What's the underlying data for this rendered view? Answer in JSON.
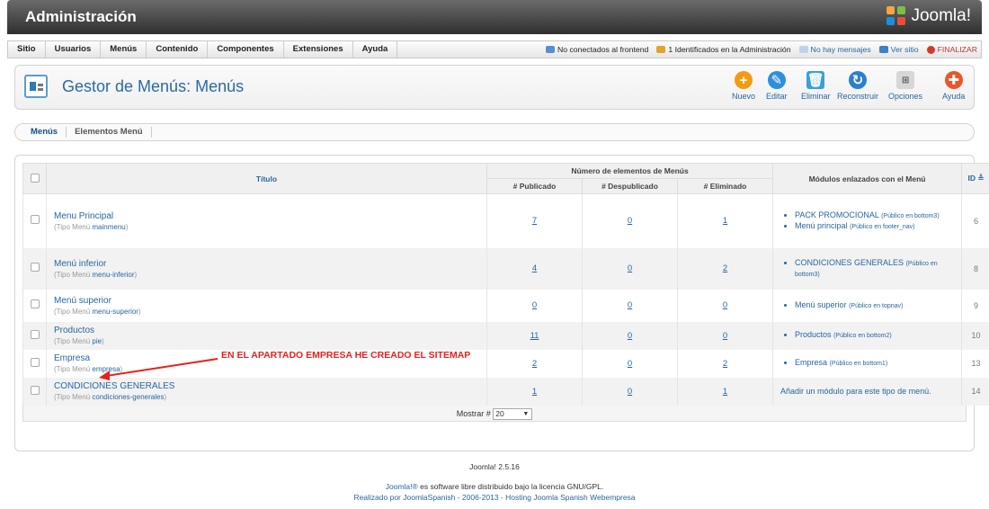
{
  "header": {
    "title": "Administración",
    "brand": "Joomla!"
  },
  "menubar": {
    "items": [
      "Sitio",
      "Usuarios",
      "Menús",
      "Contenido",
      "Componentes",
      "Extensiones",
      "Ayuda"
    ]
  },
  "status": {
    "frontend": "No conectados al frontend",
    "admin": "1 Identificados en la Administración",
    "messages": "No hay mensajes",
    "site": "Ver sitio",
    "logout": "FINALIZAR"
  },
  "toolbar": {
    "title": "Gestor de Menús: Menús",
    "new": "Nuevo",
    "edit": "Editar",
    "delete": "Eliminar",
    "rebuild": "Reconstruir",
    "options": "Opciones",
    "help": "Ayuda"
  },
  "tabs": [
    "Menús",
    "Elementos Menú"
  ],
  "table": {
    "headers": {
      "title": "Título",
      "group": "Número de elementos de Menús",
      "published": "# Publicado",
      "unpublished": "# Despublicado",
      "trashed": "# Eliminado",
      "modules": "Módulos enlazados con el Menú",
      "id": "ID"
    },
    "type_label": "(Tipo Menú ",
    "rows": [
      {
        "title": "Menu Principal",
        "type": "mainmenu",
        "published": "7",
        "unpublished": "0",
        "trashed": "1",
        "modules": [
          {
            "name": "PACK PROMOCIONAL",
            "info": "(Público en bottom3)"
          },
          {
            "name": "Menú principal",
            "info": "(Público en footer_nav)"
          }
        ],
        "id": "6"
      },
      {
        "title": "Menú inferior",
        "type": "menu-inferior",
        "published": "4",
        "unpublished": "0",
        "trashed": "2",
        "modules": [
          {
            "name": "CONDICIONES GENERALES",
            "info": "(Público en bottom3)"
          }
        ],
        "id": "8"
      },
      {
        "title": "Menú superior",
        "type": "menu-superior",
        "published": "0",
        "unpublished": "0",
        "trashed": "0",
        "modules": [
          {
            "name": "Menú superior",
            "info": "(Público en topnav)"
          }
        ],
        "id": "9"
      },
      {
        "title": "Productos",
        "type": "pie",
        "published": "11",
        "unpublished": "0",
        "trashed": "0",
        "modules": [
          {
            "name": "Productos",
            "info": "(Público en bottom2)"
          }
        ],
        "id": "10"
      },
      {
        "title": "Empresa",
        "type": "empresa",
        "published": "2",
        "unpublished": "0",
        "trashed": "2",
        "modules": [
          {
            "name": "Empresa",
            "info": "(Público en bottom1)"
          }
        ],
        "id": "13"
      },
      {
        "title": "CONDICIONES GENERALES",
        "type": "condiciones-generales",
        "published": "1",
        "unpublished": "0",
        "trashed": "1",
        "modules": [],
        "add_module": "Añadir un módulo para este tipo de menú.",
        "id": "14"
      }
    ],
    "show_label": "Mostrar #",
    "show_value": "20"
  },
  "annotation": "EN EL APARTADO EMPRESA HE CREADO EL SITEMAP",
  "footer": {
    "version": "Joomla! 2.5.16",
    "license_link": "Joomla!®",
    "license_text": " es software libre distribuido bajo la licencia GNU/GPL.",
    "credits": "Realizado por JoomlaSpanish - 2006-2013 - Hosting Joomla Spanish Webempresa"
  }
}
